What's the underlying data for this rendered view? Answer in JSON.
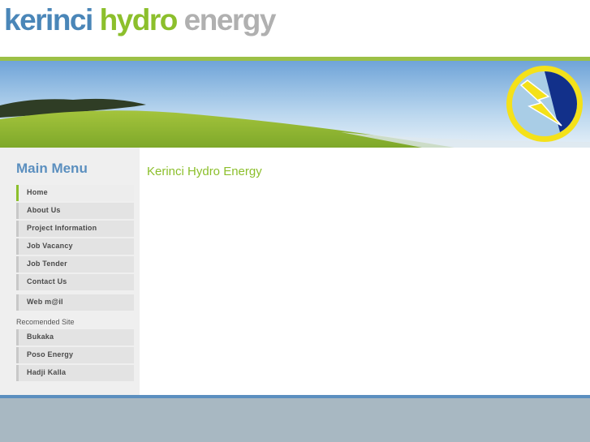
{
  "header": {
    "logo_word1": "kerinci",
    "logo_word2": "hydro",
    "logo_word3": "energy"
  },
  "colors": {
    "brand_blue": "#4a86b8",
    "brand_green": "#8cbf2c",
    "brand_gray": "#b0b0b0",
    "footer": "#a8b8c2"
  },
  "banner": {
    "icon": "lightning-bolt-logo-icon"
  },
  "sidebar": {
    "title": "Main Menu",
    "items": [
      {
        "label": "Home"
      },
      {
        "label": "About Us"
      },
      {
        "label": "Project Information"
      },
      {
        "label": "Job Vacancy"
      },
      {
        "label": "Job Tender"
      },
      {
        "label": "Contact Us"
      },
      {
        "label": "Web m@il"
      }
    ],
    "recommended_title": "Recomended Site",
    "recommended_items": [
      {
        "label": "Bukaka"
      },
      {
        "label": "Poso Energy"
      },
      {
        "label": "Hadji Kalla"
      }
    ]
  },
  "main": {
    "title": "Kerinci Hydro Energy"
  }
}
